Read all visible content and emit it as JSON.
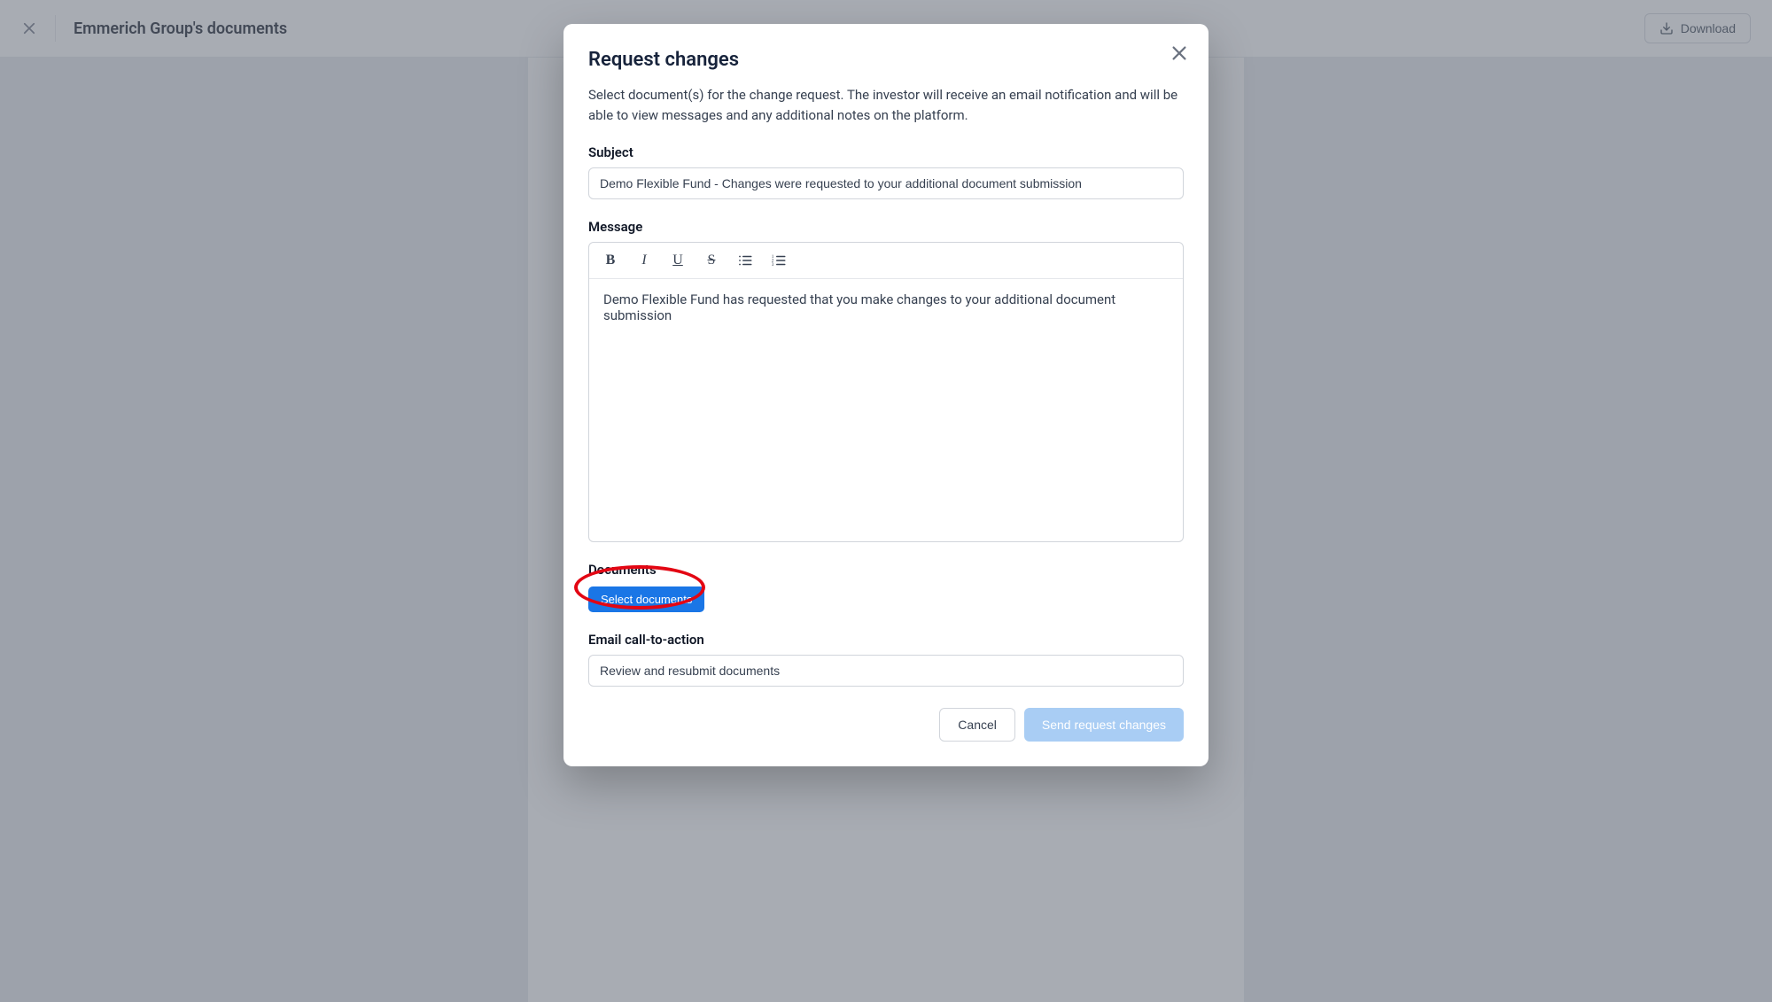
{
  "topbar": {
    "page_title": "Emmerich Group's documents",
    "download_label": "Download"
  },
  "modal": {
    "title": "Request changes",
    "description": "Select document(s) for the change request. The investor will receive an email notification and will be able to view messages and any additional notes on the platform.",
    "subject_label": "Subject",
    "subject_value": "Demo Flexible Fund - Changes were requested to your additional document submission",
    "message_label": "Message",
    "message_value": "Demo Flexible Fund has requested that you make changes to your additional document submission",
    "documents_label": "Documents",
    "select_documents_label": "Select documents",
    "cta_label": "Email call-to-action",
    "cta_value": "Review and resubmit documents",
    "cancel_label": "Cancel",
    "send_label": "Send request changes"
  }
}
